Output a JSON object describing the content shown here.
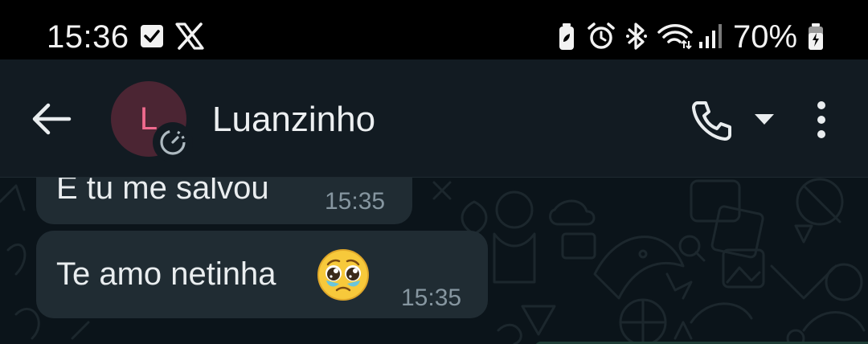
{
  "status_bar": {
    "time": "15:36",
    "battery_percent": "70%",
    "left_icons": [
      "check-box-notification-icon",
      "x-logo-icon"
    ],
    "right_icons": [
      "battery-saver-icon",
      "alarm-icon",
      "bluetooth-icon",
      "wifi-icon",
      "signal-icon",
      "battery-charging-icon"
    ]
  },
  "header": {
    "contact_name": "Luanzinho",
    "avatar_letter": "L",
    "avatar_color": "#4b2533",
    "avatar_letter_color": "#f06a8e"
  },
  "messages": [
    {
      "text": "E tu me salvou",
      "time": "15:35",
      "direction": "incoming"
    },
    {
      "text": "Te amo netinha",
      "emoji": "pleading-face",
      "time": "15:35",
      "direction": "incoming"
    }
  ],
  "colors": {
    "bubble_incoming": "#202c33",
    "app_bar": "#121b22",
    "chat_background": "#0b141a"
  }
}
